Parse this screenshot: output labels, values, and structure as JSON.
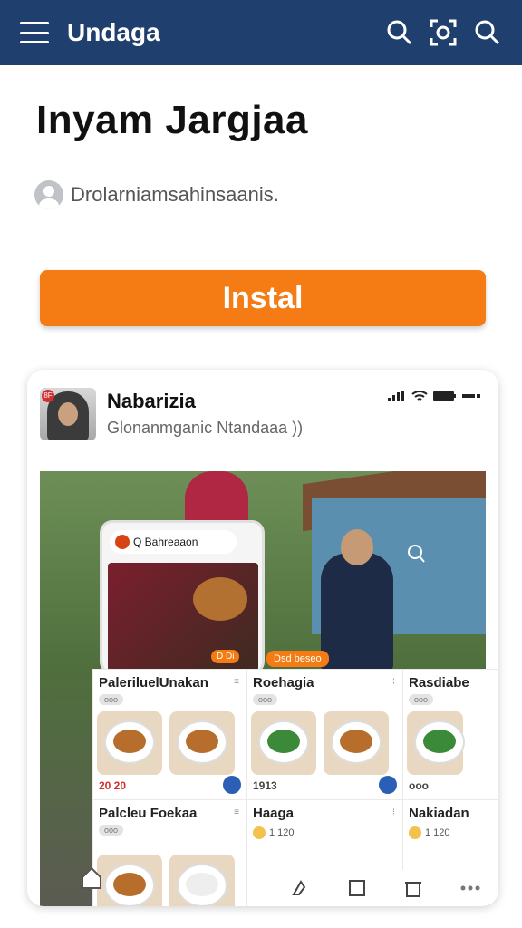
{
  "header": {
    "app_title": "Undaga",
    "icons": [
      "menu-icon",
      "search-icon",
      "scan-icon",
      "profile-search-icon"
    ]
  },
  "page": {
    "title": "Inyam Jargjaa",
    "subtitle": "Drolarniamsahinsaanis.",
    "install_label": "Instal"
  },
  "preview": {
    "profile_name": "Nabarizia",
    "profile_sub": "Glonanmganic Ntandaaa",
    "profile_sub_chevron": "))",
    "profile_badge": "8F",
    "phone_search": "Q Bahreaaon",
    "phone_tag": "D Di",
    "scene_tag": "Dsd beseo"
  },
  "tiles": [
    {
      "name": "PaleriluelUnakan",
      "pill": "ooo",
      "price": "20 20"
    },
    {
      "name": "Roehagia",
      "pill": "ooo",
      "price": "1913"
    },
    {
      "name": "Rasdiabe",
      "pill": "ooo",
      "price": "ooo"
    },
    {
      "name": "Palcleu Foekaa",
      "pill": "ooo",
      "price": ""
    },
    {
      "name": "Haaga",
      "count": "1 120"
    },
    {
      "name": "Nakiadan",
      "count": "1 120"
    }
  ],
  "colors": {
    "header_bg": "#1f3f6e",
    "install_bg": "#f57c14",
    "accent_red": "#d32f2f"
  }
}
